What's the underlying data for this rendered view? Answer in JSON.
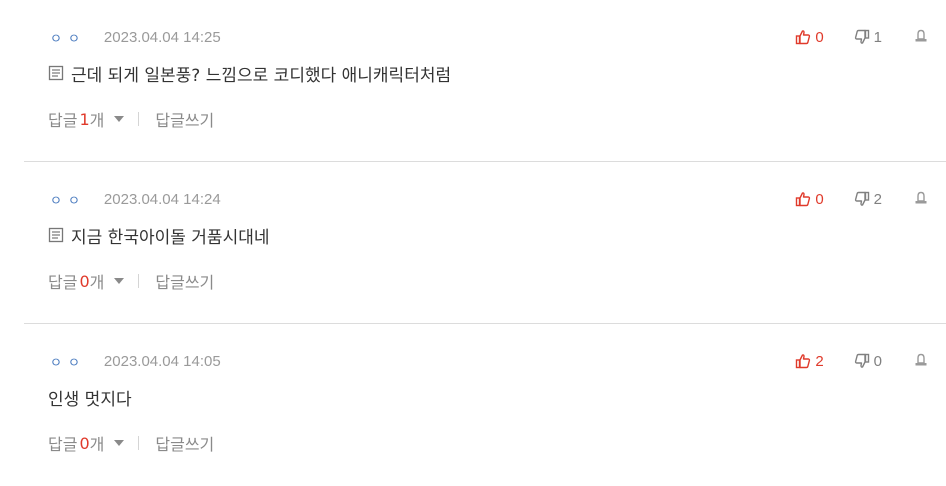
{
  "comments": [
    {
      "author": "ㅇㅇ",
      "date": "2023.04.04 14:25",
      "has_memo_icon": true,
      "text": "근데 되게 일본풍? 느낌으로 코디했다 애니캐릭터처럼",
      "likes": "0",
      "dislikes": "1",
      "reply_label": "답글",
      "reply_count": "1",
      "reply_unit": "개",
      "write_reply_label": "답글쓰기"
    },
    {
      "author": "ㅇㅇ",
      "date": "2023.04.04 14:24",
      "has_memo_icon": true,
      "text": "지금 한국아이돌 거품시대네",
      "likes": "0",
      "dislikes": "2",
      "reply_label": "답글",
      "reply_count": "0",
      "reply_unit": "개",
      "write_reply_label": "답글쓰기"
    },
    {
      "author": "ㅇㅇ",
      "date": "2023.04.04 14:05",
      "has_memo_icon": false,
      "text": "인생 멋지다",
      "likes": "2",
      "dislikes": "0",
      "reply_label": "답글",
      "reply_count": "0",
      "reply_unit": "개",
      "write_reply_label": "답글쓰기"
    }
  ],
  "icons": {
    "like": "thumbs-up-icon",
    "dislike": "thumbs-down-icon",
    "report": "report-icon",
    "memo": "memo-icon"
  },
  "colors": {
    "like": "#e03a2b",
    "dislike": "#808080",
    "reply_count": "#e03a2b",
    "author": "#4a7bbf",
    "divider": "#dcdcdc"
  }
}
